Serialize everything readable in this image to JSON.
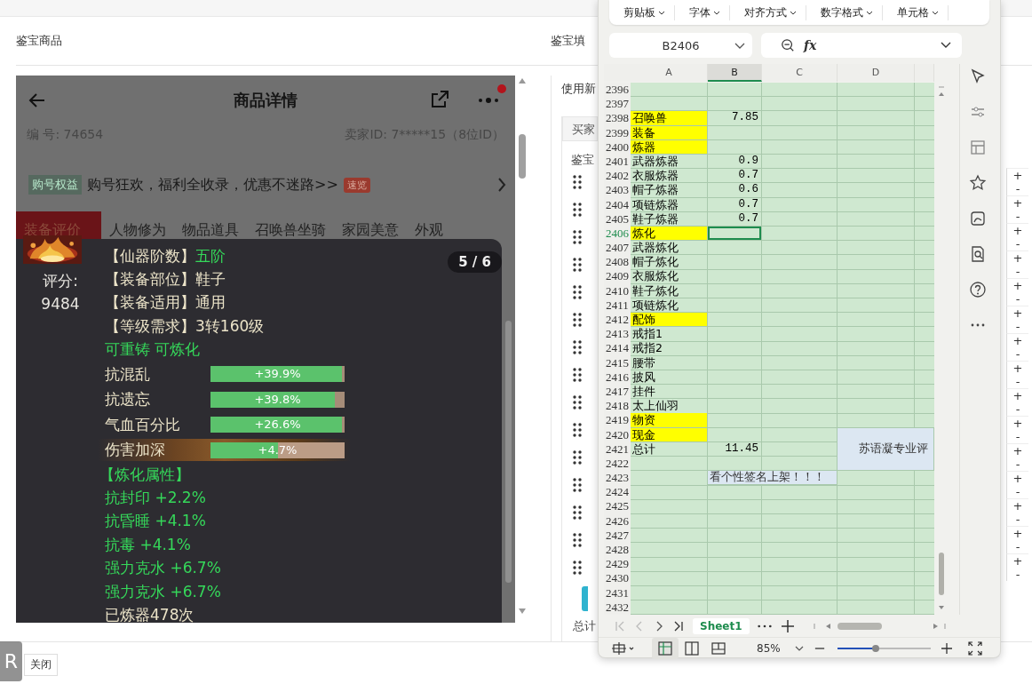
{
  "page": {
    "left_title": "鉴宝商品",
    "right_title": "鉴宝填",
    "close_button": "关闭",
    "floating_badge": "R"
  },
  "phone": {
    "title": "商品详情",
    "notification_dot": true,
    "serial": "编 号: 74654",
    "seller": "卖家ID: 7*****15（8位ID）",
    "banner": {
      "tag": "购号权益",
      "text": "购号狂欢，福利全收录，优惠不迷路>>",
      "badge": "速览"
    },
    "tabs": [
      {
        "label": "装备评价",
        "selected": true
      },
      {
        "label": "人物修为",
        "selected": false
      },
      {
        "label": "物品道具",
        "selected": false
      },
      {
        "label": "召唤兽坐骑",
        "selected": false
      },
      {
        "label": "家园美意",
        "selected": false
      },
      {
        "label": "外观",
        "selected": false
      }
    ]
  },
  "item_popup": {
    "score_label": "评分:",
    "score": "9484",
    "counter": "5 / 6",
    "attributes": [
      {
        "label": "【仙器阶数】",
        "value": "五阶",
        "highlight": true
      },
      {
        "label": "【装备部位】",
        "value": "鞋子",
        "highlight": false
      },
      {
        "label": "【装备适用】",
        "value": "通用",
        "highlight": false
      },
      {
        "label": "【等级需求】",
        "value": "3转160级",
        "highlight": false
      }
    ],
    "flags": "可重铸 可炼化",
    "bars": [
      {
        "name": "抗混乱",
        "reading": "+39.9%",
        "level": 0.98,
        "glow": false
      },
      {
        "name": "抗遗忘",
        "reading": "+39.8%",
        "level": 0.93,
        "glow": false
      },
      {
        "name": "气血百分比",
        "reading": "+26.6%",
        "level": 0.98,
        "glow": false
      },
      {
        "name": "伤害加深",
        "reading": "+4.7%",
        "level": 0.5,
        "glow": true
      }
    ],
    "refine_title": "【炼化属性】",
    "refine_lines": [
      "抗封印 +2.2%",
      "抗昏睡 +4.1%",
      "抗毒 +4.1%",
      "强力克水 +6.7%",
      "强力克水 +6.7%"
    ],
    "footer": "已炼器478次"
  },
  "right_panel": {
    "option": "使用新",
    "buyer_tab": "买家",
    "section": "鉴宝",
    "total": "总计",
    "rows": [
      {
        "plus": "+",
        "minus": "-"
      },
      {
        "plus": "+",
        "minus": "-"
      },
      {
        "plus": "+",
        "minus": "-"
      },
      {
        "plus": "+",
        "minus": "-"
      },
      {
        "plus": "+",
        "minus": "-"
      },
      {
        "plus": "+",
        "minus": "-"
      },
      {
        "plus": "+",
        "minus": "-"
      },
      {
        "plus": "+",
        "minus": "-"
      },
      {
        "plus": "+",
        "minus": "-"
      },
      {
        "plus": "+",
        "minus": "-"
      },
      {
        "plus": "+",
        "minus": "-"
      },
      {
        "plus": "+",
        "minus": "-"
      },
      {
        "plus": "+",
        "minus": "-"
      },
      {
        "plus": "+",
        "minus": "-"
      },
      {
        "plus": "+",
        "minus": "-"
      }
    ]
  },
  "spreadsheet": {
    "ribbon_groups": [
      "剪贴板",
      "字体",
      "对齐方式",
      "数字格式",
      "单元格"
    ],
    "name_box": "B2406",
    "formula_label": "fx",
    "columns": [
      {
        "label": "A",
        "selected": false
      },
      {
        "label": "B",
        "selected": true
      },
      {
        "label": "C",
        "selected": false
      },
      {
        "label": "D",
        "selected": false
      }
    ],
    "rows": [
      {
        "row": "2396",
        "highlight": false,
        "selected": false
      },
      {
        "row": "2397",
        "highlight": false,
        "selected": false
      },
      {
        "row": "2398",
        "a": "召唤兽",
        "b": "7.85",
        "highlight": true,
        "selected": false
      },
      {
        "row": "2399",
        "a": "装备",
        "highlight": true,
        "selected": false
      },
      {
        "row": "2400",
        "a": "炼器",
        "highlight": true,
        "selected": false
      },
      {
        "row": "2401",
        "a": "武器炼器",
        "b": "0.9",
        "highlight": false,
        "selected": false
      },
      {
        "row": "2402",
        "a": "衣服炼器",
        "b": "0.7",
        "highlight": false,
        "selected": false
      },
      {
        "row": "2403",
        "a": "帽子炼器",
        "b": "0.6",
        "highlight": false,
        "selected": false
      },
      {
        "row": "2404",
        "a": "项链炼器",
        "b": "0.7",
        "highlight": false,
        "selected": false
      },
      {
        "row": "2405",
        "a": "鞋子炼器",
        "b": "0.7",
        "highlight": false,
        "selected": false
      },
      {
        "row": "2406",
        "a": "炼化",
        "highlight": true,
        "selected": true
      },
      {
        "row": "2407",
        "a": "武器炼化",
        "highlight": false,
        "selected": false
      },
      {
        "row": "2408",
        "a": "帽子炼化",
        "highlight": false,
        "selected": false
      },
      {
        "row": "2409",
        "a": "衣服炼化",
        "highlight": false,
        "selected": false
      },
      {
        "row": "2410",
        "a": "鞋子炼化",
        "highlight": false,
        "selected": false
      },
      {
        "row": "2411",
        "a": "项链炼化",
        "highlight": false,
        "selected": false
      },
      {
        "row": "2412",
        "a": "配饰",
        "highlight": true,
        "selected": false
      },
      {
        "row": "2413",
        "a": "戒指1",
        "highlight": false,
        "selected": false
      },
      {
        "row": "2414",
        "a": "戒指2",
        "highlight": false,
        "selected": false
      },
      {
        "row": "2415",
        "a": "腰带",
        "highlight": false,
        "selected": false
      },
      {
        "row": "2416",
        "a": "披风",
        "highlight": false,
        "selected": false
      },
      {
        "row": "2417",
        "a": "挂件",
        "highlight": false,
        "selected": false
      },
      {
        "row": "2418",
        "a": "太上仙羽",
        "highlight": false,
        "selected": false
      },
      {
        "row": "2419",
        "a": "物资",
        "highlight": true,
        "selected": false
      },
      {
        "row": "2420",
        "a": "现金",
        "highlight": true,
        "selected": false,
        "merge": {
          "text": "苏语凝专业评",
          "kind": "tall"
        }
      },
      {
        "row": "2421",
        "a": "总计",
        "b": "11.45",
        "highlight": false,
        "selected": false
      },
      {
        "row": "2422",
        "highlight": false,
        "selected": false
      },
      {
        "row": "2423",
        "highlight": false,
        "selected": false,
        "merge": {
          "text": "看个性签名上架！！！",
          "kind": "wide"
        }
      },
      {
        "row": "2424",
        "highlight": false,
        "selected": false
      },
      {
        "row": "2425",
        "highlight": false,
        "selected": false
      },
      {
        "row": "2426",
        "highlight": false,
        "selected": false
      },
      {
        "row": "2427",
        "highlight": false,
        "selected": false
      },
      {
        "row": "2428",
        "highlight": false,
        "selected": false
      },
      {
        "row": "2429",
        "highlight": false,
        "selected": false
      },
      {
        "row": "2430",
        "highlight": false,
        "selected": false
      },
      {
        "row": "2431",
        "highlight": false,
        "selected": false
      },
      {
        "row": "2432",
        "highlight": false,
        "selected": false
      }
    ],
    "sheet_tab": {
      "label": "Sheet1",
      "selected": true
    },
    "zoom": {
      "reading": "85%",
      "level": 0.41
    }
  }
}
